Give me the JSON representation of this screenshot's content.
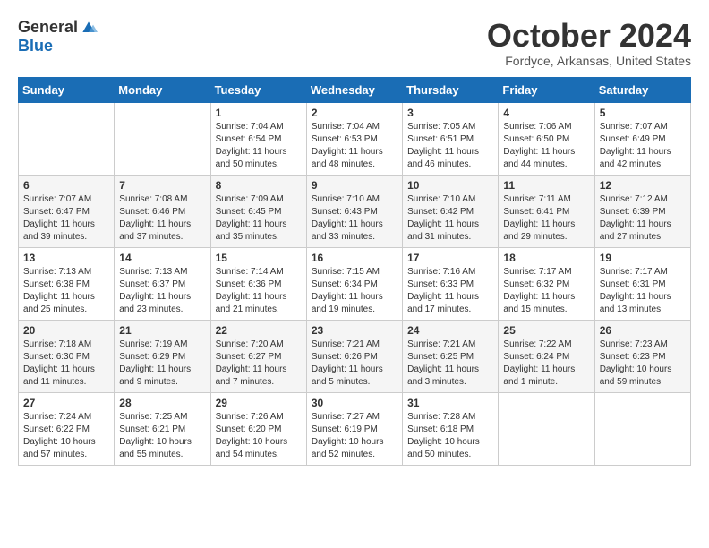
{
  "logo": {
    "general": "General",
    "blue": "Blue"
  },
  "title": "October 2024",
  "location": "Fordyce, Arkansas, United States",
  "days_of_week": [
    "Sunday",
    "Monday",
    "Tuesday",
    "Wednesday",
    "Thursday",
    "Friday",
    "Saturday"
  ],
  "weeks": [
    [
      {
        "day": "",
        "info": ""
      },
      {
        "day": "",
        "info": ""
      },
      {
        "day": "1",
        "info": "Sunrise: 7:04 AM\nSunset: 6:54 PM\nDaylight: 11 hours and 50 minutes."
      },
      {
        "day": "2",
        "info": "Sunrise: 7:04 AM\nSunset: 6:53 PM\nDaylight: 11 hours and 48 minutes."
      },
      {
        "day": "3",
        "info": "Sunrise: 7:05 AM\nSunset: 6:51 PM\nDaylight: 11 hours and 46 minutes."
      },
      {
        "day": "4",
        "info": "Sunrise: 7:06 AM\nSunset: 6:50 PM\nDaylight: 11 hours and 44 minutes."
      },
      {
        "day": "5",
        "info": "Sunrise: 7:07 AM\nSunset: 6:49 PM\nDaylight: 11 hours and 42 minutes."
      }
    ],
    [
      {
        "day": "6",
        "info": "Sunrise: 7:07 AM\nSunset: 6:47 PM\nDaylight: 11 hours and 39 minutes."
      },
      {
        "day": "7",
        "info": "Sunrise: 7:08 AM\nSunset: 6:46 PM\nDaylight: 11 hours and 37 minutes."
      },
      {
        "day": "8",
        "info": "Sunrise: 7:09 AM\nSunset: 6:45 PM\nDaylight: 11 hours and 35 minutes."
      },
      {
        "day": "9",
        "info": "Sunrise: 7:10 AM\nSunset: 6:43 PM\nDaylight: 11 hours and 33 minutes."
      },
      {
        "day": "10",
        "info": "Sunrise: 7:10 AM\nSunset: 6:42 PM\nDaylight: 11 hours and 31 minutes."
      },
      {
        "day": "11",
        "info": "Sunrise: 7:11 AM\nSunset: 6:41 PM\nDaylight: 11 hours and 29 minutes."
      },
      {
        "day": "12",
        "info": "Sunrise: 7:12 AM\nSunset: 6:39 PM\nDaylight: 11 hours and 27 minutes."
      }
    ],
    [
      {
        "day": "13",
        "info": "Sunrise: 7:13 AM\nSunset: 6:38 PM\nDaylight: 11 hours and 25 minutes."
      },
      {
        "day": "14",
        "info": "Sunrise: 7:13 AM\nSunset: 6:37 PM\nDaylight: 11 hours and 23 minutes."
      },
      {
        "day": "15",
        "info": "Sunrise: 7:14 AM\nSunset: 6:36 PM\nDaylight: 11 hours and 21 minutes."
      },
      {
        "day": "16",
        "info": "Sunrise: 7:15 AM\nSunset: 6:34 PM\nDaylight: 11 hours and 19 minutes."
      },
      {
        "day": "17",
        "info": "Sunrise: 7:16 AM\nSunset: 6:33 PM\nDaylight: 11 hours and 17 minutes."
      },
      {
        "day": "18",
        "info": "Sunrise: 7:17 AM\nSunset: 6:32 PM\nDaylight: 11 hours and 15 minutes."
      },
      {
        "day": "19",
        "info": "Sunrise: 7:17 AM\nSunset: 6:31 PM\nDaylight: 11 hours and 13 minutes."
      }
    ],
    [
      {
        "day": "20",
        "info": "Sunrise: 7:18 AM\nSunset: 6:30 PM\nDaylight: 11 hours and 11 minutes."
      },
      {
        "day": "21",
        "info": "Sunrise: 7:19 AM\nSunset: 6:29 PM\nDaylight: 11 hours and 9 minutes."
      },
      {
        "day": "22",
        "info": "Sunrise: 7:20 AM\nSunset: 6:27 PM\nDaylight: 11 hours and 7 minutes."
      },
      {
        "day": "23",
        "info": "Sunrise: 7:21 AM\nSunset: 6:26 PM\nDaylight: 11 hours and 5 minutes."
      },
      {
        "day": "24",
        "info": "Sunrise: 7:21 AM\nSunset: 6:25 PM\nDaylight: 11 hours and 3 minutes."
      },
      {
        "day": "25",
        "info": "Sunrise: 7:22 AM\nSunset: 6:24 PM\nDaylight: 11 hours and 1 minute."
      },
      {
        "day": "26",
        "info": "Sunrise: 7:23 AM\nSunset: 6:23 PM\nDaylight: 10 hours and 59 minutes."
      }
    ],
    [
      {
        "day": "27",
        "info": "Sunrise: 7:24 AM\nSunset: 6:22 PM\nDaylight: 10 hours and 57 minutes."
      },
      {
        "day": "28",
        "info": "Sunrise: 7:25 AM\nSunset: 6:21 PM\nDaylight: 10 hours and 55 minutes."
      },
      {
        "day": "29",
        "info": "Sunrise: 7:26 AM\nSunset: 6:20 PM\nDaylight: 10 hours and 54 minutes."
      },
      {
        "day": "30",
        "info": "Sunrise: 7:27 AM\nSunset: 6:19 PM\nDaylight: 10 hours and 52 minutes."
      },
      {
        "day": "31",
        "info": "Sunrise: 7:28 AM\nSunset: 6:18 PM\nDaylight: 10 hours and 50 minutes."
      },
      {
        "day": "",
        "info": ""
      },
      {
        "day": "",
        "info": ""
      }
    ]
  ]
}
